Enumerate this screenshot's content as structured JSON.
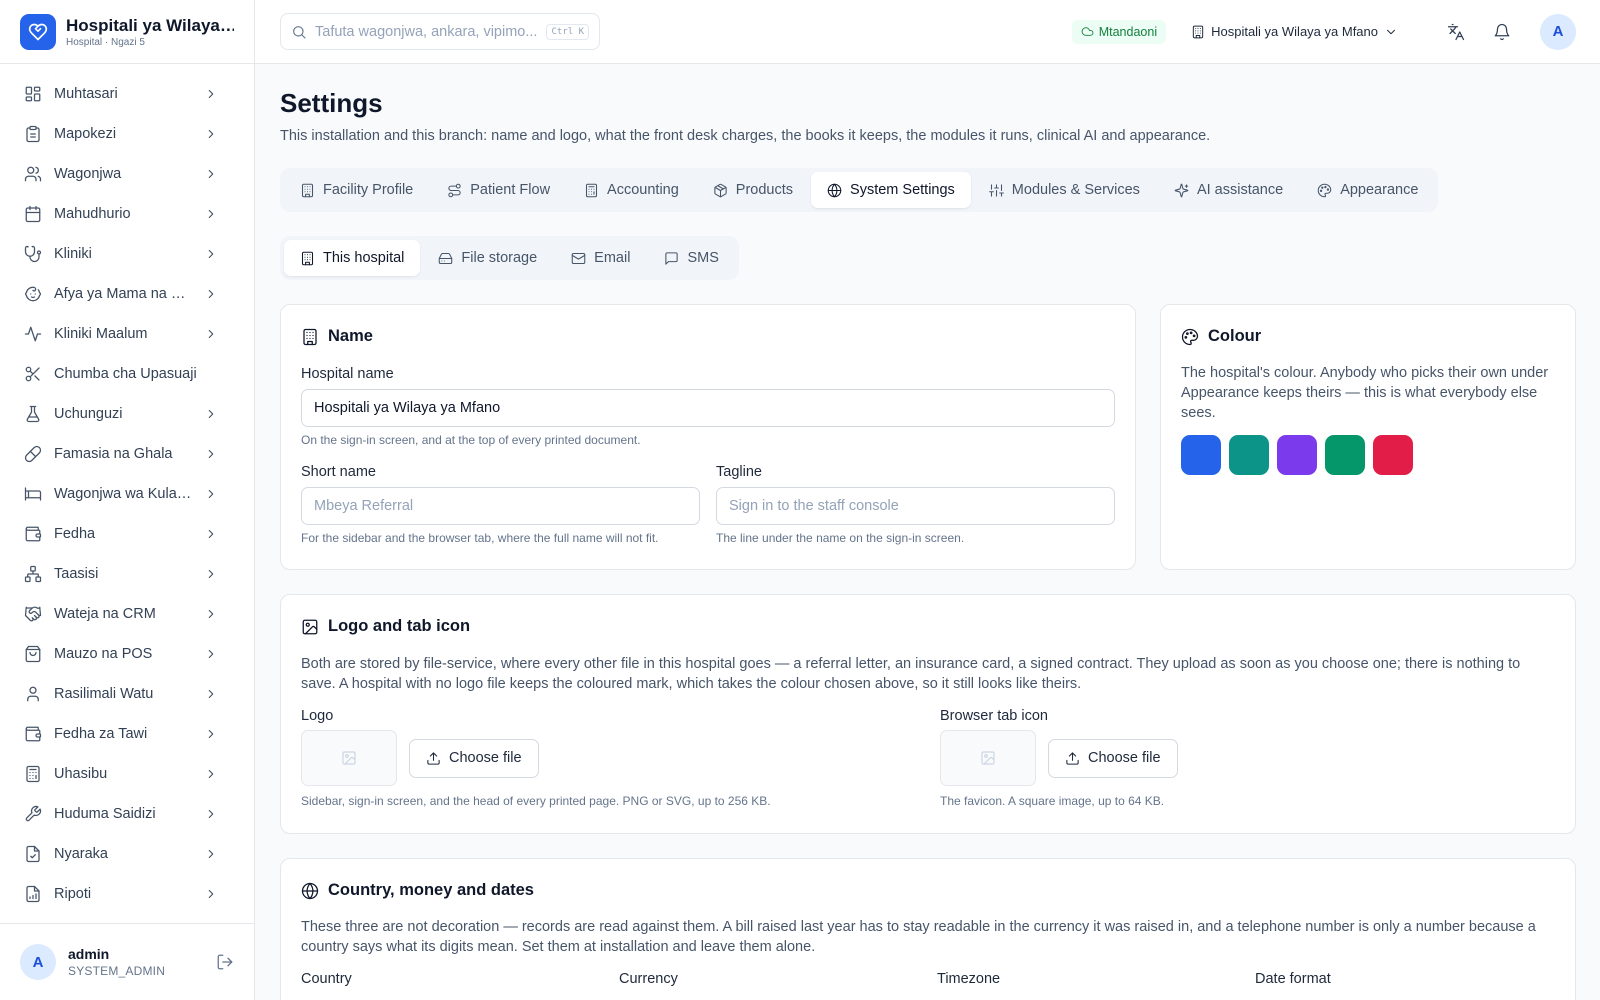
{
  "app": {
    "name": "Hospitali ya Wilaya ya Mfano",
    "subtitle": "Hospital · Ngazi 5"
  },
  "sidebar": {
    "items": [
      {
        "label": "Muhtasari",
        "icon": "dashboard-icon",
        "chevron": true
      },
      {
        "label": "Mapokezi",
        "icon": "clipboard-icon",
        "chevron": true
      },
      {
        "label": "Wagonjwa",
        "icon": "users-icon",
        "chevron": true
      },
      {
        "label": "Mahudhurio",
        "icon": "calendar-icon",
        "chevron": true
      },
      {
        "label": "Kliniki",
        "icon": "stethoscope-icon",
        "chevron": true
      },
      {
        "label": "Afya ya Mama na Mtoto",
        "icon": "baby-icon",
        "chevron": true
      },
      {
        "label": "Kliniki Maalum",
        "icon": "activity-icon",
        "chevron": true
      },
      {
        "label": "Chumba cha Upasuaji",
        "icon": "scissors-icon",
        "chevron": false
      },
      {
        "label": "Uchunguzi",
        "icon": "flask-icon",
        "chevron": true
      },
      {
        "label": "Famasia na Ghala",
        "icon": "pill-icon",
        "chevron": true
      },
      {
        "label": "Wagonjwa wa Kulazwa",
        "icon": "bed-icon",
        "chevron": true
      },
      {
        "label": "Fedha",
        "icon": "wallet-icon",
        "chevron": true
      },
      {
        "label": "Taasisi",
        "icon": "network-icon",
        "chevron": true
      },
      {
        "label": "Wateja na CRM",
        "icon": "handshake-icon",
        "chevron": true
      },
      {
        "label": "Mauzo na POS",
        "icon": "shopping-bag-icon",
        "chevron": true
      },
      {
        "label": "Rasilimali Watu",
        "icon": "user-icon",
        "chevron": true
      },
      {
        "label": "Fedha za Tawi",
        "icon": "wallet-icon",
        "chevron": true
      },
      {
        "label": "Uhasibu",
        "icon": "calculator-icon",
        "chevron": true
      },
      {
        "label": "Huduma Saidizi",
        "icon": "wrench-icon",
        "chevron": true
      },
      {
        "label": "Nyaraka",
        "icon": "file-icon",
        "chevron": true
      },
      {
        "label": "Ripoti",
        "icon": "chart-icon",
        "chevron": true
      }
    ],
    "user": {
      "initial": "A",
      "name": "admin",
      "role": "SYSTEM_ADMIN"
    }
  },
  "topbar": {
    "search_placeholder": "Tafuta wagonjwa, ankara, vipimo...",
    "shortcut": "Ctrl K",
    "status": "Mtandaoni",
    "branch": "Hospitali ya Wilaya ya Mfano",
    "avatar_initial": "A"
  },
  "page": {
    "title": "Settings",
    "description": "This installation and this branch: name and logo, what the front desk charges, the books it keeps, the modules it runs, clinical AI and appearance."
  },
  "tabs": [
    {
      "label": "Facility Profile",
      "icon": "building-icon",
      "active": false
    },
    {
      "label": "Patient Flow",
      "icon": "route-icon",
      "active": false
    },
    {
      "label": "Accounting",
      "icon": "calculator-icon",
      "active": false
    },
    {
      "label": "Products",
      "icon": "package-icon",
      "active": false
    },
    {
      "label": "System Settings",
      "icon": "globe-icon",
      "active": true
    },
    {
      "label": "Modules & Services",
      "icon": "sliders-icon",
      "active": false
    },
    {
      "label": "AI assistance",
      "icon": "sparkles-icon",
      "active": false
    },
    {
      "label": "Appearance",
      "icon": "palette-icon",
      "active": false
    }
  ],
  "subtabs": [
    {
      "label": "This hospital",
      "icon": "building-icon",
      "active": true
    },
    {
      "label": "File storage",
      "icon": "hard-drive-icon",
      "active": false
    },
    {
      "label": "Email",
      "icon": "mail-icon",
      "active": false
    },
    {
      "label": "SMS",
      "icon": "message-icon",
      "active": false
    }
  ],
  "name_card": {
    "title": "Name",
    "hospital_name_label": "Hospital name",
    "hospital_name_value": "Hospitali ya Wilaya ya Mfano",
    "hospital_name_hint": "On the sign-in screen, and at the top of every printed document.",
    "short_name_label": "Short name",
    "short_name_placeholder": "Mbeya Referral",
    "short_name_hint": "For the sidebar and the browser tab, where the full name will not fit.",
    "tagline_label": "Tagline",
    "tagline_placeholder": "Sign in to the staff console",
    "tagline_hint": "The line under the name on the sign-in screen."
  },
  "colour_card": {
    "title": "Colour",
    "description": "The hospital's colour. Anybody who picks their own under Appearance keeps theirs — this is what everybody else sees.",
    "swatches": [
      "#2563eb",
      "#0d9488",
      "#7c3aed",
      "#059669",
      "#e11d48"
    ]
  },
  "logo_card": {
    "title": "Logo and tab icon",
    "description": "Both are stored by file-service, where every other file in this hospital goes — a referral letter, an insurance card, a signed contract. They upload as soon as you choose one; there is nothing to save. A hospital with no logo file keeps the coloured mark, which takes the colour chosen above, so it still looks like theirs.",
    "logo_label": "Logo",
    "logo_button": "Choose file",
    "logo_hint": "Sidebar, sign-in screen, and the head of every printed page. PNG or SVG, up to 256 KB.",
    "favicon_label": "Browser tab icon",
    "favicon_button": "Choose file",
    "favicon_hint": "The favicon. A square image, up to 64 KB."
  },
  "country_card": {
    "title": "Country, money and dates",
    "description": "These three are not decoration — records are read against them. A bill raised last year has to stay readable in the currency it was raised in, and a telephone number is only a number because a country says what its digits mean. Set them at installation and leave them alone.",
    "country_label": "Country",
    "currency_label": "Currency",
    "timezone_label": "Timezone",
    "date_format_label": "Date format"
  },
  "colors": {
    "accent": "#2563eb",
    "online": "#15803d"
  }
}
